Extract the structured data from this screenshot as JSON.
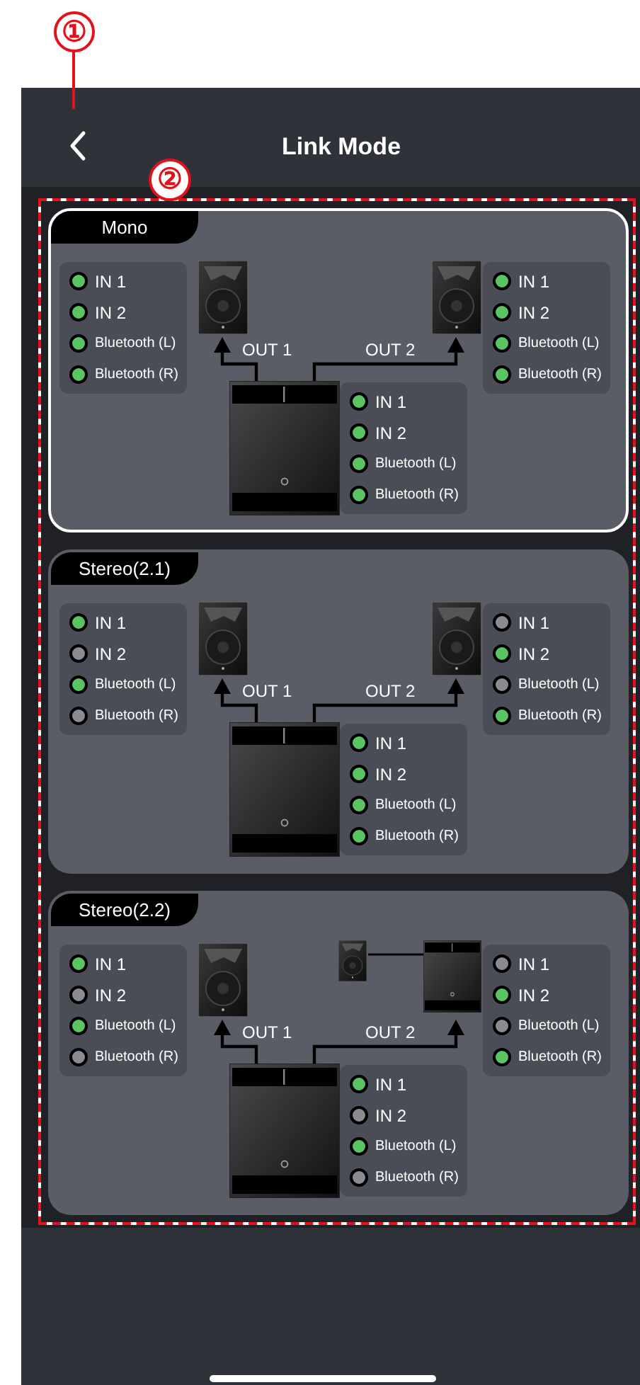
{
  "callouts": [
    {
      "label": "①"
    },
    {
      "label": "②"
    }
  ],
  "header": {
    "title": "Link Mode"
  },
  "modes": [
    {
      "label": "Mono",
      "selected": true,
      "out_labels": [
        "OUT 1",
        "OUT 2"
      ],
      "right_unit": {
        "kind": "speaker"
      },
      "left": [
        {
          "label": "IN 1",
          "kind": "input",
          "on": true
        },
        {
          "label": "IN 2",
          "kind": "input",
          "on": true
        },
        {
          "label": "Bluetooth (L)",
          "kind": "bluetooth",
          "on": true
        },
        {
          "label": "Bluetooth (R)",
          "kind": "bluetooth",
          "on": true
        }
      ],
      "right": [
        {
          "label": "IN 1",
          "kind": "input",
          "on": true
        },
        {
          "label": "IN 2",
          "kind": "input",
          "on": true
        },
        {
          "label": "Bluetooth (L)",
          "kind": "bluetooth",
          "on": true
        },
        {
          "label": "Bluetooth (R)",
          "kind": "bluetooth",
          "on": true
        }
      ],
      "sub": [
        {
          "label": "IN 1",
          "kind": "input",
          "on": true
        },
        {
          "label": "IN 2",
          "kind": "input",
          "on": true
        },
        {
          "label": "Bluetooth (L)",
          "kind": "bluetooth",
          "on": true
        },
        {
          "label": "Bluetooth (R)",
          "kind": "bluetooth",
          "on": true
        }
      ]
    },
    {
      "label": "Stereo(2.1)",
      "selected": false,
      "out_labels": [
        "OUT 1",
        "OUT 2"
      ],
      "right_unit": {
        "kind": "speaker"
      },
      "left": [
        {
          "label": "IN 1",
          "kind": "input",
          "on": true
        },
        {
          "label": "IN 2",
          "kind": "input",
          "on": false
        },
        {
          "label": "Bluetooth (L)",
          "kind": "bluetooth",
          "on": true
        },
        {
          "label": "Bluetooth (R)",
          "kind": "bluetooth",
          "on": false
        }
      ],
      "right": [
        {
          "label": "IN 1",
          "kind": "input",
          "on": false
        },
        {
          "label": "IN 2",
          "kind": "input",
          "on": true
        },
        {
          "label": "Bluetooth (L)",
          "kind": "bluetooth",
          "on": false
        },
        {
          "label": "Bluetooth (R)",
          "kind": "bluetooth",
          "on": true
        }
      ],
      "sub": [
        {
          "label": "IN 1",
          "kind": "input",
          "on": true
        },
        {
          "label": "IN 2",
          "kind": "input",
          "on": true
        },
        {
          "label": "Bluetooth (L)",
          "kind": "bluetooth",
          "on": true
        },
        {
          "label": "Bluetooth (R)",
          "kind": "bluetooth",
          "on": true
        }
      ]
    },
    {
      "label": "Stereo(2.2)",
      "selected": false,
      "out_labels": [
        "OUT 1",
        "OUT 2"
      ],
      "right_unit": {
        "kind": "speaker_with_sub"
      },
      "left": [
        {
          "label": "IN 1",
          "kind": "input",
          "on": true
        },
        {
          "label": "IN 2",
          "kind": "input",
          "on": false
        },
        {
          "label": "Bluetooth (L)",
          "kind": "bluetooth",
          "on": true
        },
        {
          "label": "Bluetooth (R)",
          "kind": "bluetooth",
          "on": false
        }
      ],
      "right": [
        {
          "label": "IN 1",
          "kind": "input",
          "on": false
        },
        {
          "label": "IN 2",
          "kind": "input",
          "on": true
        },
        {
          "label": "Bluetooth (L)",
          "kind": "bluetooth",
          "on": false
        },
        {
          "label": "Bluetooth (R)",
          "kind": "bluetooth",
          "on": true
        }
      ],
      "sub": [
        {
          "label": "IN 1",
          "kind": "input",
          "on": true
        },
        {
          "label": "IN 2",
          "kind": "input",
          "on": false
        },
        {
          "label": "Bluetooth (L)",
          "kind": "bluetooth",
          "on": true
        },
        {
          "label": "Bluetooth (R)",
          "kind": "bluetooth",
          "on": false
        }
      ]
    }
  ]
}
